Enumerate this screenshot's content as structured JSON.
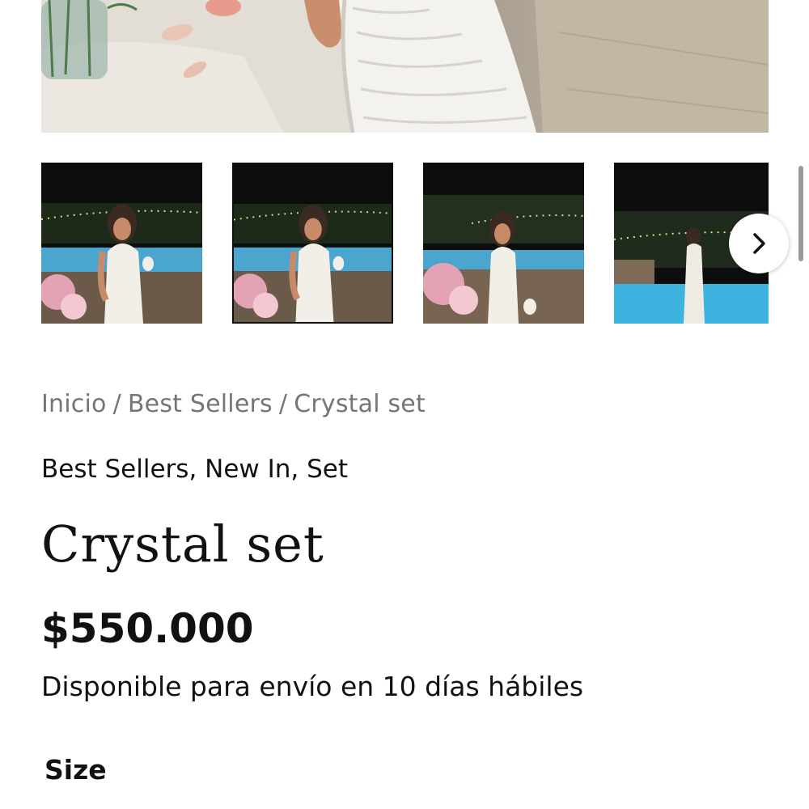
{
  "gallery": {
    "main_image_alt": "Crystal set",
    "thumbnails": [
      {
        "name": "thumbnail-1",
        "active": false
      },
      {
        "name": "thumbnail-2",
        "active": true
      },
      {
        "name": "thumbnail-3",
        "active": false
      },
      {
        "name": "thumbnail-4",
        "active": false
      }
    ],
    "next_icon": "chevron-right-icon"
  },
  "breadcrumb": {
    "items": [
      "Inicio",
      "Best Sellers",
      "Crystal set"
    ],
    "separator": "/"
  },
  "product": {
    "categories": "Best Sellers, New In, Set",
    "title": "Crystal set",
    "price": "$550.000",
    "availability": "Disponible para envío en 10 días hábiles",
    "size_label": "Size"
  },
  "colors": {
    "breadcrumb": "#757575",
    "text": "#111111",
    "background": "#ffffff"
  }
}
